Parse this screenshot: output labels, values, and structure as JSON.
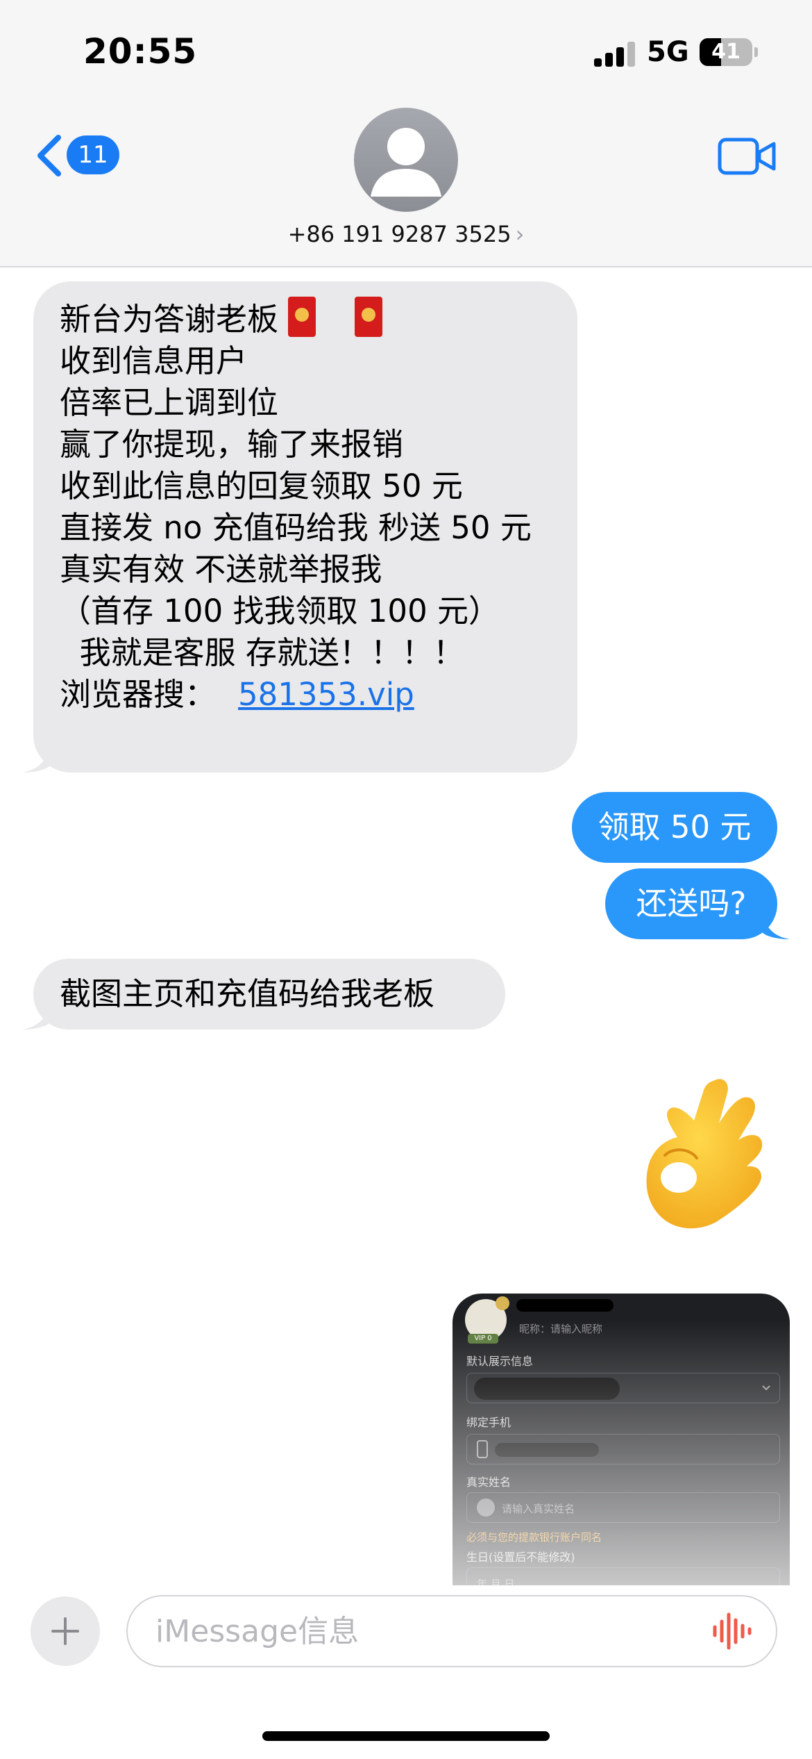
{
  "status_bar": {
    "time": "20:55",
    "network": "5G",
    "battery": "41",
    "battery_level_percent": 41
  },
  "header": {
    "back_badge": "11",
    "contact": "+86 191 9287 3525",
    "contact_chevron": "›",
    "icons": {
      "back": "chevron-left-icon",
      "avatar": "person-silhouette-icon",
      "video": "video-camera-icon"
    }
  },
  "messages": [
    {
      "side": "incoming",
      "lines": [
        "新台为答谢老板",
        "",
        "收到信息用户",
        "倍率已上调到位",
        "赢了你提现，输了来报销",
        "收到此信息的回复领取 50 元",
        "直接发 no 充值码给我 秒送 50 元",
        "真实有效 不送就举报我",
        "（首存 100 找我领取 100 元）",
        "  我就是客服 存就送！！！！",
        "浏览器搜："
      ],
      "link": "581353.vip",
      "emoji": [
        "red-envelope-icon",
        "red-envelope-icon"
      ]
    },
    {
      "side": "outgoing",
      "text": "领取 50 元"
    },
    {
      "side": "outgoing",
      "text": "还送吗?"
    },
    {
      "side": "incoming",
      "text": "截图主页和充值码给我老板"
    },
    {
      "side": "outgoing",
      "emoji": "ok-hand-emoji-icon"
    }
  ],
  "attachment": {
    "nickname_label": "昵称：请输入昵称",
    "default_info_label": "默认展示信息",
    "bind_phone_label": "绑定手机",
    "real_name_label": "真实姓名",
    "real_name_placeholder": "请输入真实姓名",
    "real_name_warning": "必须与您的提款银行账户同名",
    "birthday_label": "生日(设置后不能修改)",
    "birthday_placeholder": "年 月 日",
    "level_badge": "VIP 0"
  },
  "composer": {
    "placeholder": "iMessage信息",
    "value": "",
    "icons": {
      "plus": "plus-icon",
      "voice": "voice-waveform-icon"
    }
  },
  "colors": {
    "outgoing_bubble": "#2a97fb",
    "incoming_bubble": "#e9e9eb",
    "accent": "#1a7cf5",
    "voice_icon": "#ef5b4a"
  }
}
